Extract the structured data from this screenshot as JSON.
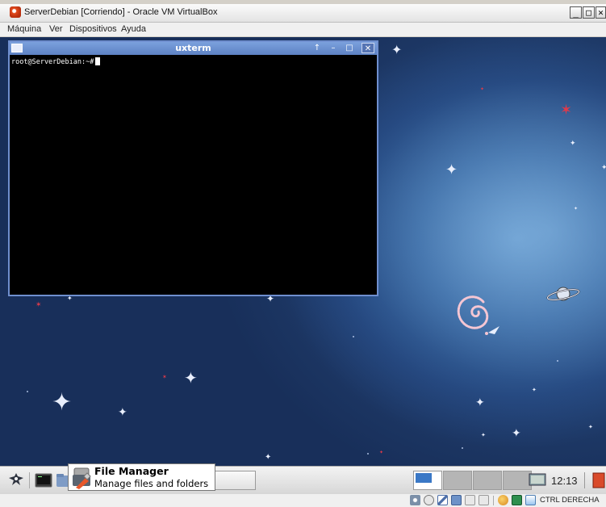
{
  "window": {
    "title": "ServerDebian [Corriendo] - Oracle VM VirtualBox",
    "controls": [
      "_",
      "□",
      "✕"
    ]
  },
  "menubar": {
    "items": [
      "Máquina",
      "Ver",
      "Dispositivos",
      "Ayuda"
    ]
  },
  "terminal": {
    "title": "uxterm",
    "prompt": "root@ServerDebian:~#",
    "buttons": [
      "↑",
      "–",
      "□",
      "✕"
    ]
  },
  "tooltip": {
    "title": "File Manager",
    "description": "Manage files and folders"
  },
  "panel": {
    "clock": "12:13"
  },
  "statusbar": {
    "host_key": "CTRL DERECHA"
  },
  "colors": {
    "desktop_blue": "#203f75",
    "term_titlebar": "#6d92d2",
    "vbox_icon": "#e24a1d"
  }
}
